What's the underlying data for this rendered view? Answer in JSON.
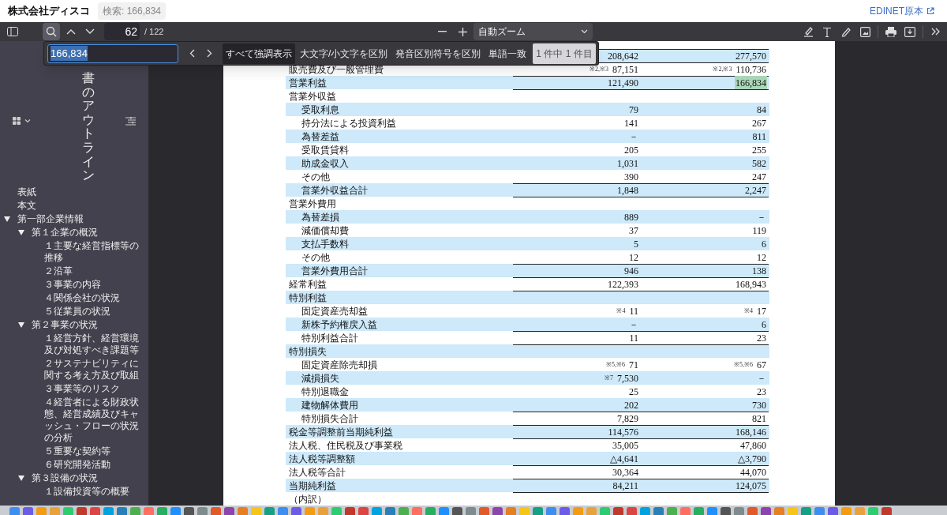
{
  "header": {
    "title": "株式会社ディスコ",
    "search_badge": "検索: 166,834",
    "source_link": "EDINET原本"
  },
  "toolbar": {
    "find_selected": true,
    "page_number": "62",
    "page_count": "/ 122",
    "zoom": "自動ズーム"
  },
  "find_bar": {
    "query": "166,834",
    "result": "1 件中 1 件目",
    "options": [
      {
        "label": "すべて強調表示",
        "selected": true
      },
      {
        "label": "大文字/小文字を区別",
        "selected": false
      },
      {
        "label": "発音区別符号を区別",
        "selected": false
      },
      {
        "label": "単語一致",
        "selected": false
      }
    ]
  },
  "sidebar": {
    "title": "書のアウトライン",
    "items": [
      {
        "label": "表紙"
      },
      {
        "label": "本文"
      },
      {
        "label": "第一部企業情報",
        "expanded": true,
        "children": [
          {
            "label": "第１企業の概況",
            "expanded": true,
            "children": [
              {
                "label": "１主要な経営指標等の推移"
              },
              {
                "label": "２沿革"
              },
              {
                "label": "３事業の内容"
              },
              {
                "label": "４関係会社の状況"
              },
              {
                "label": "５従業員の状況"
              }
            ]
          },
          {
            "label": "第２事業の状況",
            "expanded": true,
            "children": [
              {
                "label": "１経営方針、経営環境及び対処すべき課題等"
              },
              {
                "label": "２サステナビリティに関する考え方及び取組"
              },
              {
                "label": "３事業等のリスク"
              },
              {
                "label": "４経営者による財政状態、経営成績及びキャッシュ・フローの状況の分析"
              },
              {
                "label": "５重要な契約等"
              },
              {
                "label": "６研究開発活動"
              }
            ]
          },
          {
            "label": "第３設備の状況",
            "expanded": true,
            "children": [
              {
                "label": "１設備投資等の概要"
              }
            ]
          }
        ]
      }
    ]
  },
  "table": {
    "rows": [
      {
        "rule": true,
        "values": [
          {
            "text": "208,642",
            "match": false
          },
          {
            "text": "277,570",
            "match": false
          }
        ]
      },
      {
        "label": "販売費及び一般管理費",
        "rule": true,
        "values": [
          {
            "note": "※2,※3",
            "text": "87,151",
            "match": false
          },
          {
            "note": "※2,※3",
            "text": "110,736",
            "match": false
          }
        ]
      },
      {
        "label": "営業利益",
        "rule": true,
        "values": [
          {
            "text": "121,490",
            "match": false
          },
          {
            "text": "166,834",
            "match": true
          }
        ]
      },
      {
        "label": "営業外収益",
        "rule": true,
        "children": [
          {
            "label": "受取利息",
            "rule": false,
            "values": [
              {
                "text": "79",
                "match": false
              },
              {
                "text": "84",
                "match": false
              }
            ]
          },
          {
            "label": "持分法による投資利益",
            "rule": false,
            "values": [
              {
                "text": "141",
                "match": false
              },
              {
                "text": "267",
                "match": false
              }
            ]
          },
          {
            "label": "為替差益",
            "rule": false,
            "values": [
              {
                "text": "－",
                "match": false
              },
              {
                "text": "811",
                "match": false
              }
            ]
          },
          {
            "label": "受取賃貸料",
            "rule": false,
            "values": [
              {
                "text": "205",
                "match": false
              },
              {
                "text": "255",
                "match": false
              }
            ]
          },
          {
            "label": "助成金収入",
            "rule": false,
            "values": [
              {
                "text": "1,031",
                "match": false
              },
              {
                "text": "582",
                "match": false
              }
            ]
          },
          {
            "label": "その他",
            "rule": false,
            "values": [
              {
                "text": "390",
                "match": false
              },
              {
                "text": "247",
                "match": false
              }
            ]
          },
          {
            "label": "営業外収益合計",
            "rule": true,
            "values": [
              {
                "text": "1,848",
                "match": false
              },
              {
                "text": "2,247",
                "match": false
              }
            ]
          }
        ]
      },
      {
        "label": "営業外費用",
        "rule": true,
        "children": [
          {
            "label": "為替差損",
            "rule": false,
            "values": [
              {
                "text": "889",
                "match": false
              },
              {
                "text": "－",
                "match": false
              }
            ]
          },
          {
            "label": "減価償却費",
            "rule": false,
            "values": [
              {
                "text": "37",
                "match": false
              },
              {
                "text": "119",
                "match": false
              }
            ]
          },
          {
            "label": "支払手数料",
            "rule": false,
            "values": [
              {
                "text": "5",
                "match": false
              },
              {
                "text": "6",
                "match": false
              }
            ]
          },
          {
            "label": "その他",
            "rule": false,
            "values": [
              {
                "text": "12",
                "match": false
              },
              {
                "text": "12",
                "match": false
              }
            ]
          },
          {
            "label": "営業外費用合計",
            "rule": true,
            "values": [
              {
                "text": "946",
                "match": false
              },
              {
                "text": "138",
                "match": false
              }
            ]
          }
        ]
      },
      {
        "label": "経常利益",
        "rule": true,
        "values": [
          {
            "text": "122,393",
            "match": false
          },
          {
            "text": "168,943",
            "match": false
          }
        ]
      },
      {
        "label": "特別利益",
        "rule": true,
        "children": [
          {
            "label": "固定資産売却益",
            "rule": false,
            "values": [
              {
                "note": "※4",
                "text": "11",
                "match": false
              },
              {
                "note": "※4",
                "text": "17",
                "match": false
              }
            ]
          },
          {
            "label": "新株予約権戻入益",
            "rule": false,
            "values": [
              {
                "text": "－",
                "match": false
              },
              {
                "text": "6",
                "match": false
              }
            ]
          },
          {
            "label": "特別利益合計",
            "rule": true,
            "values": [
              {
                "text": "11",
                "match": false
              },
              {
                "text": "23",
                "match": false
              }
            ]
          }
        ]
      },
      {
        "label": "特別損失",
        "rule": true,
        "children": [
          {
            "label": "固定資産除売却損",
            "rule": false,
            "values": [
              {
                "note": "※5,※6",
                "text": "71",
                "match": false
              },
              {
                "note": "※5,※6",
                "text": "67",
                "match": false
              }
            ]
          },
          {
            "label": "減損損失",
            "rule": false,
            "values": [
              {
                "note": "※7",
                "text": "7,530",
                "match": false
              },
              {
                "text": "－",
                "match": false
              }
            ]
          },
          {
            "label": "特別退職金",
            "rule": false,
            "values": [
              {
                "text": "25",
                "match": false
              },
              {
                "text": "23",
                "match": false
              }
            ]
          },
          {
            "label": "建物解体費用",
            "rule": false,
            "values": [
              {
                "text": "202",
                "match": false
              },
              {
                "text": "730",
                "match": false
              }
            ]
          },
          {
            "label": "特別損失合計",
            "rule": true,
            "values": [
              {
                "text": "7,829",
                "match": false
              },
              {
                "text": "821",
                "match": false
              }
            ]
          }
        ]
      },
      {
        "label": "税金等調整前当期純利益",
        "rule": true,
        "values": [
          {
            "text": "114,576",
            "match": false
          },
          {
            "text": "168,146",
            "match": false
          }
        ]
      },
      {
        "label": "法人税、住民税及び事業税",
        "rule": true,
        "values": [
          {
            "text": "35,005",
            "match": false
          },
          {
            "text": "47,860",
            "match": false
          }
        ]
      },
      {
        "label": "法人税等調整額",
        "rule": false,
        "values": [
          {
            "text": "△4,641",
            "match": false
          },
          {
            "text": "△3,790",
            "match": false
          }
        ]
      },
      {
        "label": "法人税等合計",
        "rule": true,
        "values": [
          {
            "text": "30,364",
            "match": false
          },
          {
            "text": "44,070",
            "match": false
          }
        ]
      },
      {
        "label": "当期純利益",
        "rule": true,
        "values": [
          {
            "text": "84,211",
            "match": false
          },
          {
            "text": "124,075",
            "match": false
          }
        ]
      },
      {
        "label": "（内訳）",
        "rule": true
      }
    ]
  }
}
